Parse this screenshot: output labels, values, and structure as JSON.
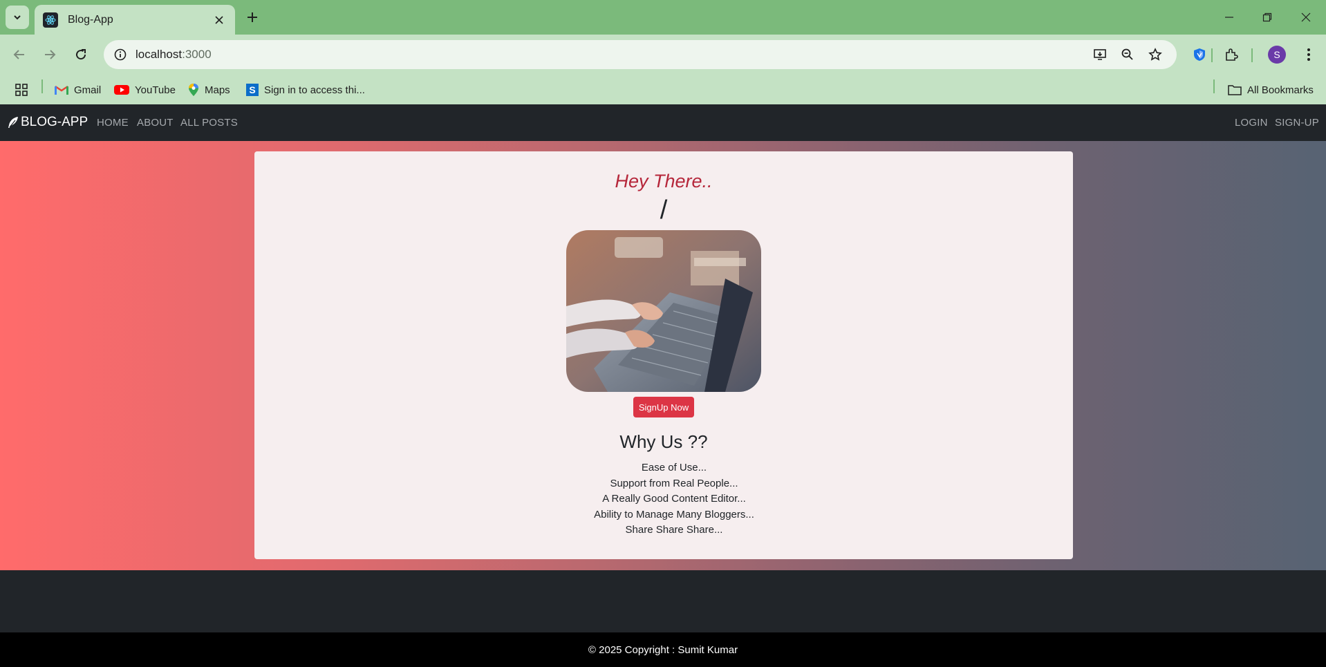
{
  "browser": {
    "tab_title": "Blog-App",
    "url_host": "localhost",
    "url_port": ":3000",
    "profile_initial": "S",
    "accent": "#7bba7b",
    "bookmarks": [
      {
        "label": "Gmail",
        "icon": "gmail-icon"
      },
      {
        "label": "YouTube",
        "icon": "youtube-icon"
      },
      {
        "label": "Maps",
        "icon": "maps-icon"
      },
      {
        "label": "Sign in to access thi...",
        "icon": "s-icon"
      }
    ],
    "all_bookmarks": "All Bookmarks"
  },
  "navbar": {
    "brand": "BLOG-APP",
    "links": [
      "HOME",
      "ABOUT",
      "ALL POSTS"
    ],
    "right_links": [
      "LOGIN",
      "SIGN-UP"
    ]
  },
  "hero": {
    "greeting": "Hey There..",
    "path": "/",
    "signup_label": "SignUp Now",
    "why_title": "Why Us ??",
    "reasons": [
      "Ease of Use...",
      "Support from Real People...",
      "A Really Good Content Editor...",
      "Ability to Manage Many Bloggers...",
      "Share Share Share..."
    ],
    "primary_color": "#dc3545"
  },
  "footer": {
    "text": "© 2025 Copyright : Sumit Kumar"
  }
}
